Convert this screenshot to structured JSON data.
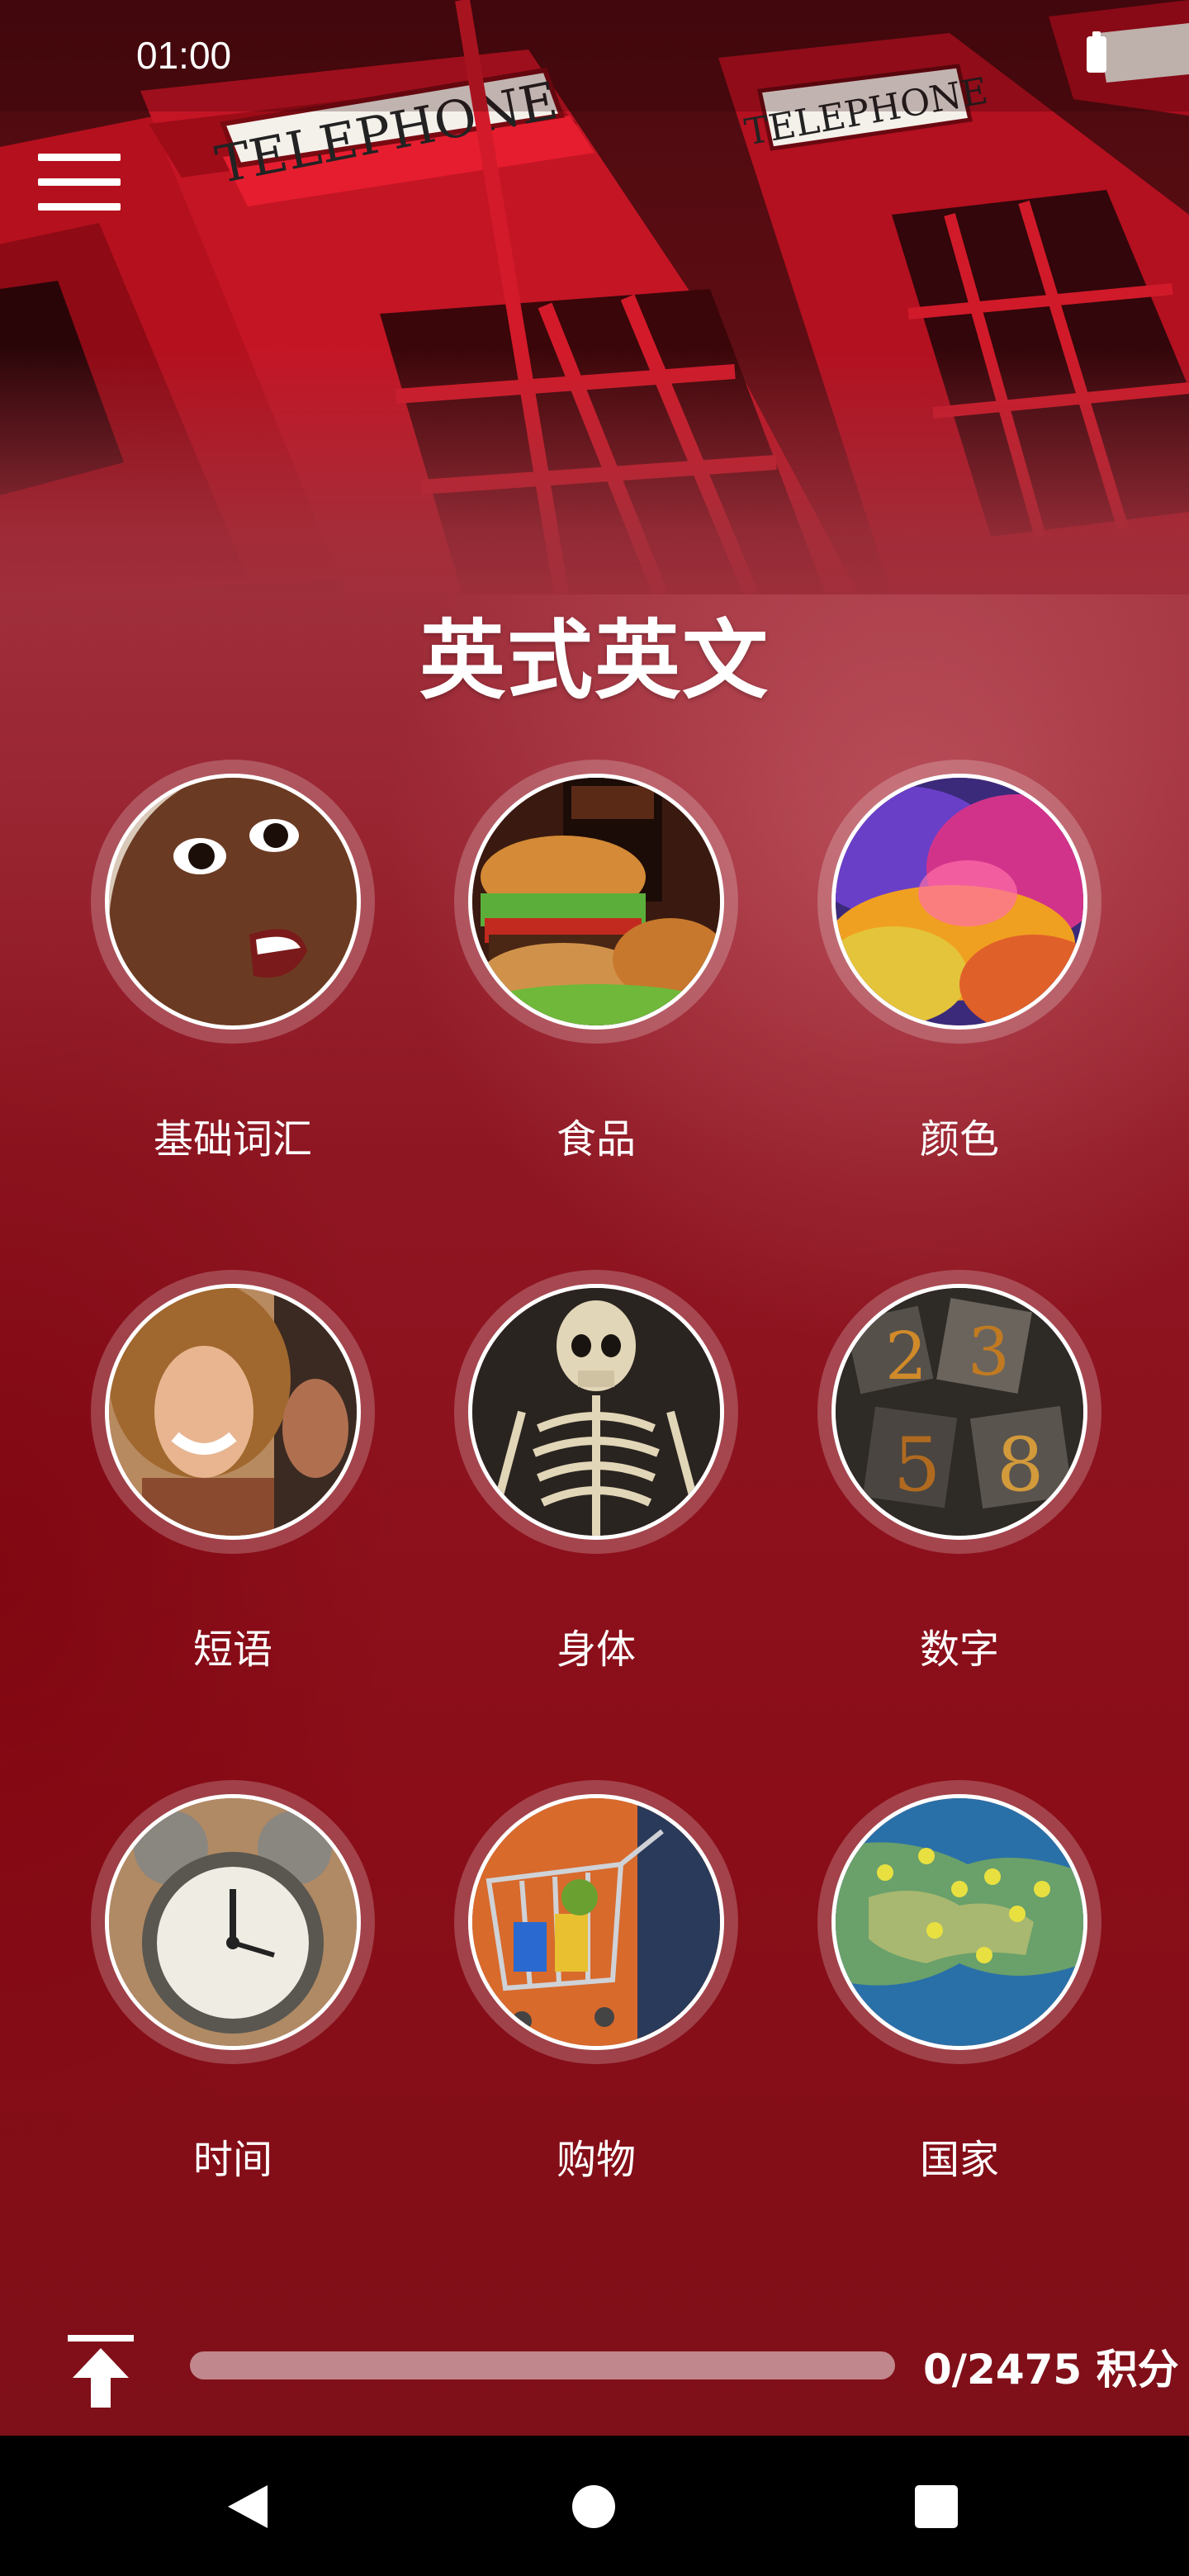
{
  "status": {
    "time": "01:00"
  },
  "header": {
    "title": "英式英文",
    "hero_sign": "TELEPHONE"
  },
  "categories": [
    {
      "label": "基础词汇",
      "icon": "baby-face-photo"
    },
    {
      "label": "食品",
      "icon": "burger-meal-photo"
    },
    {
      "label": "颜色",
      "icon": "color-powder-photo"
    },
    {
      "label": "短语",
      "icon": "smiling-woman-photo"
    },
    {
      "label": "身体",
      "icon": "skeleton-photo"
    },
    {
      "label": "数字",
      "icon": "wooden-numbers-photo"
    },
    {
      "label": "时间",
      "icon": "alarm-clock-photo"
    },
    {
      "label": "购物",
      "icon": "shopping-cart-photo"
    },
    {
      "label": "国家",
      "icon": "map-pins-photo"
    }
  ],
  "progress": {
    "score_text": "0/2475 积分",
    "fraction": 0.0
  },
  "colors": {
    "primary": "#a0303c",
    "accent": "#ffffff"
  }
}
